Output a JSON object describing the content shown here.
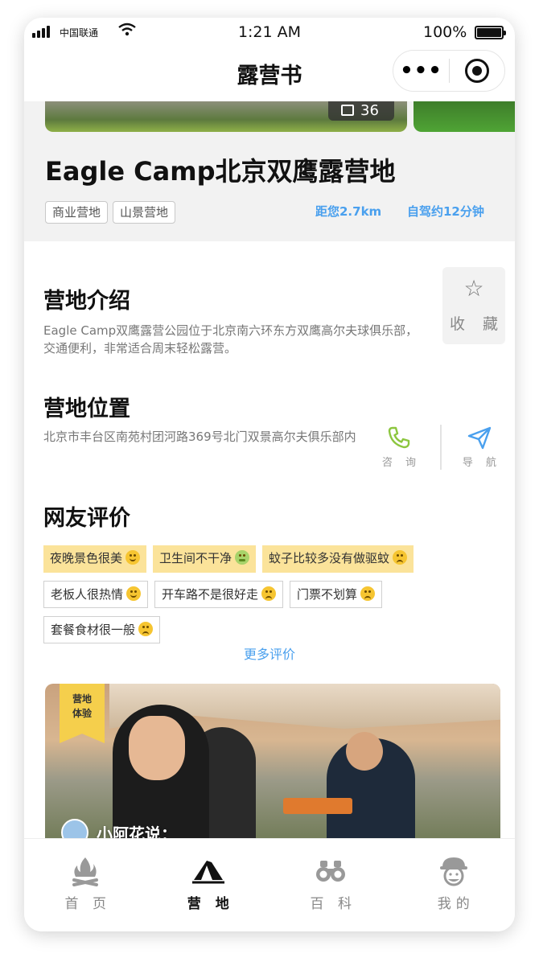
{
  "status_bar": {
    "carrier": "中国联通",
    "time": "1:21 AM",
    "battery": "100%"
  },
  "navbar": {
    "title": "露营书",
    "more_label": "•••"
  },
  "hero": {
    "photo_count": "36",
    "camp_name": "Eagle Camp北京双鹰露营地",
    "tags": [
      "商业营地",
      "山景营地"
    ],
    "distance": "距您2.7km",
    "drive_time": "自驾约12分钟"
  },
  "intro": {
    "title": "营地介绍",
    "text": "Eagle Camp双鹰露营公园位于北京南六环东方双鹰高尔夫球俱乐部，交通便利，非常适合周末轻松露营。",
    "favorite_label": "收 藏"
  },
  "location": {
    "title": "营地位置",
    "address": "北京市丰台区南苑村团河路369号北门双景高尔夫俱乐部内",
    "call_label": "咨 询",
    "nav_label": "导 航"
  },
  "reviews": {
    "title": "网友评价",
    "rows": [
      [
        {
          "text": "夜晚景色很美",
          "mood": "happy",
          "highlight": true
        },
        {
          "text": "卫生间不干净",
          "mood": "sick",
          "highlight": true
        },
        {
          "text": "蚊子比较多没有做驱蚊",
          "mood": "sad",
          "highlight": true
        }
      ],
      [
        {
          "text": "老板人很热情",
          "mood": "happy",
          "highlight": false
        },
        {
          "text": "开车路不是很好走",
          "mood": "sad",
          "highlight": false
        },
        {
          "text": "门票不划算",
          "mood": "sad",
          "highlight": false
        }
      ],
      [
        {
          "text": "套餐食材很一般",
          "mood": "sad",
          "highlight": false
        }
      ]
    ],
    "more_label": "更多评价"
  },
  "story": {
    "badge_line1": "营地",
    "badge_line2": "体验",
    "author": "小阿花说："
  },
  "tabbar": {
    "items": [
      {
        "label": "首 页",
        "active": false
      },
      {
        "label": "营 地",
        "active": true
      },
      {
        "label": "百 科",
        "active": false
      },
      {
        "label": "我的",
        "active": false
      }
    ]
  },
  "colors": {
    "accent": "#4aa0ee",
    "call_green": "#8cc63f",
    "highlight": "#fbe39a",
    "badge": "#f5cf4c"
  }
}
